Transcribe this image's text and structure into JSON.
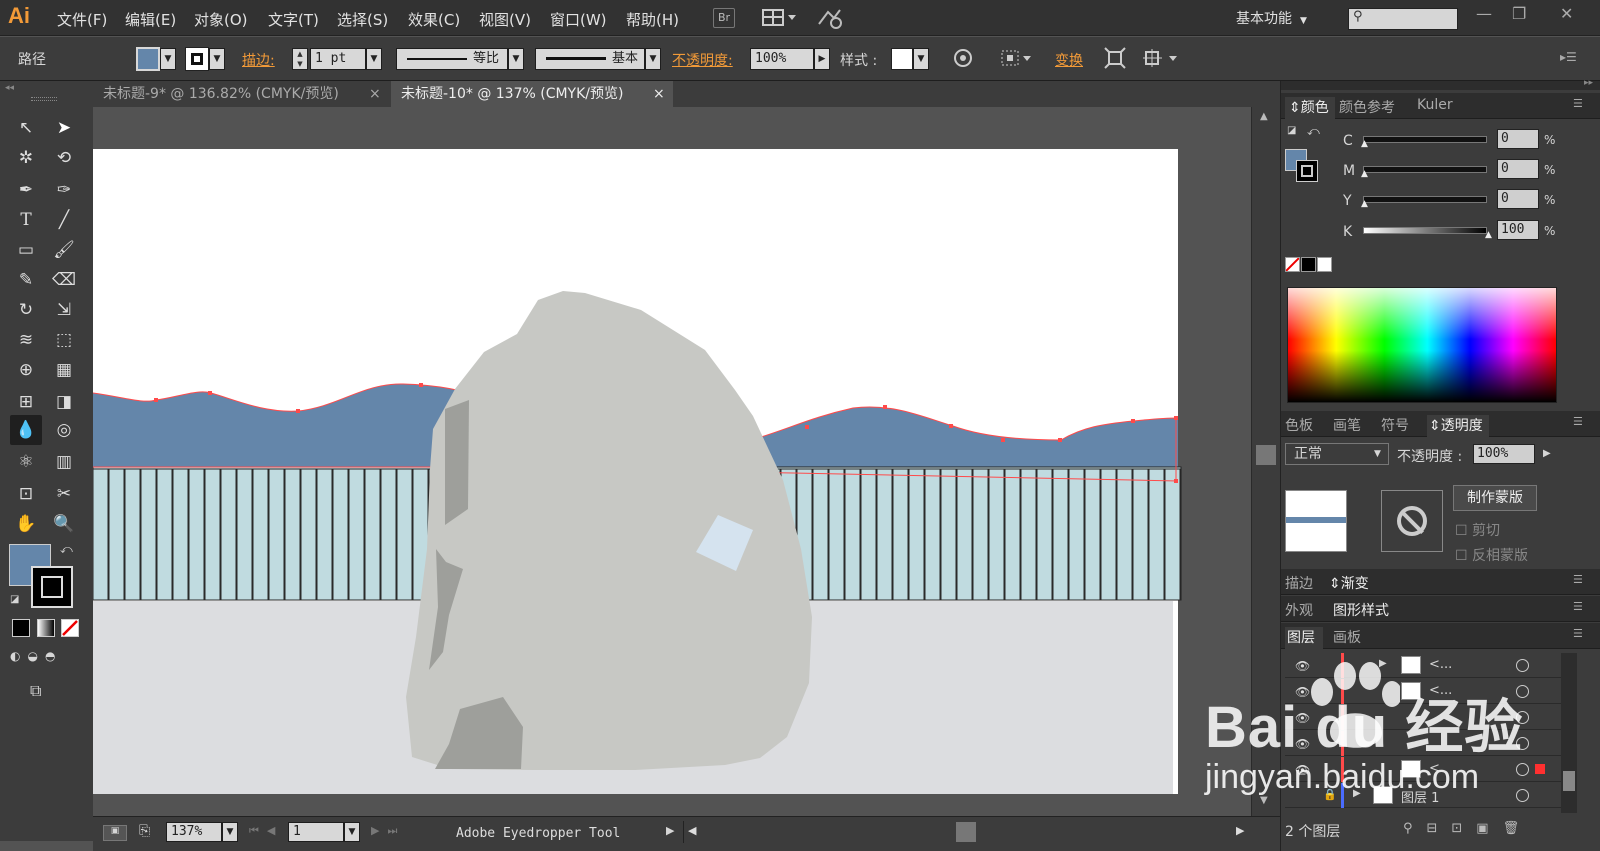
{
  "app": {
    "logo": "Ai"
  },
  "menu": [
    "文件(F)",
    "编辑(E)",
    "对象(O)",
    "文字(T)",
    "选择(S)",
    "效果(C)",
    "视图(V)",
    "窗口(W)",
    "帮助(H)"
  ],
  "menubar_buttons": {
    "bridge": "Br"
  },
  "workspace": {
    "label": "基本功能"
  },
  "control": {
    "object_type": "路径",
    "stroke_label": "描边",
    "stroke_weight": "1 pt",
    "profile_label": "等比",
    "brush_label": "基本",
    "opacity_label": "不透明度",
    "opacity_value": "100%",
    "style_label": "样式",
    "transform_label": "变换"
  },
  "tabs": [
    {
      "label": "未标题-9* @ 136.82% (CMYK/预览)",
      "close": "×"
    },
    {
      "label": "未标题-10* @ 137% (CMYK/预览)",
      "close": "×"
    }
  ],
  "colors": {
    "fill": "#6486aa",
    "mountain": "#6486aa",
    "fence": "#c0dbe0",
    "ground": "#dcdde0",
    "rock": "#c7c8c4",
    "rock_shadow": "#9e9f9b",
    "selection": "#ff4a4a",
    "accent": "#f29a38"
  },
  "color_panel": {
    "tabs": [
      "颜色",
      "颜色参考",
      "Kuler"
    ],
    "channels": [
      {
        "label": "C",
        "value": "0",
        "unit": "%"
      },
      {
        "label": "M",
        "value": "0",
        "unit": "%"
      },
      {
        "label": "Y",
        "value": "0",
        "unit": "%"
      },
      {
        "label": "K",
        "value": "100",
        "unit": "%"
      }
    ]
  },
  "transparency_panel": {
    "tabs": [
      "色板",
      "画笔",
      "符号",
      "透明度"
    ],
    "blend_mode": "正常",
    "opacity_label": "不透明度",
    "opacity_value": "100%",
    "make_mask": "制作蒙版",
    "clip": "剪切",
    "invert_mask": "反相蒙版"
  },
  "stroke_gradient_tabs": [
    "描边",
    "渐变"
  ],
  "appearance_tabs": [
    "外观",
    "图形样式"
  ],
  "layers_panel": {
    "tabs": [
      "图层",
      "画板"
    ],
    "rows": [
      {
        "name": "<..."
      },
      {
        "name": "<..."
      },
      {
        "name": ""
      },
      {
        "name": ""
      },
      {
        "name": "<"
      },
      {
        "name": "图层 1"
      }
    ],
    "count": "2 个图层"
  },
  "status": {
    "zoom": "137%",
    "page": "1",
    "tool_name": "Adobe Eyedropper Tool"
  },
  "watermark": {
    "brand": "Bai du 经验",
    "url": "jingyan.baidu.com"
  }
}
